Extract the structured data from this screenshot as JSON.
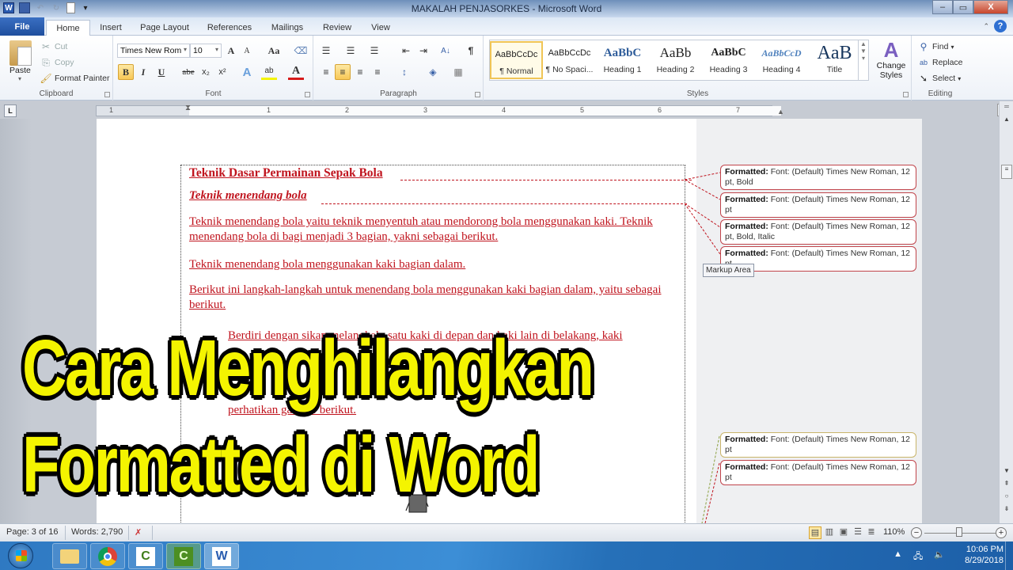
{
  "window": {
    "title": "MAKALAH PENJASORKES - Microsoft Word",
    "minimize": "–",
    "maximize": "▭",
    "close": "X"
  },
  "quick_access": [
    {
      "name": "word-logo-icon",
      "glyph": "W"
    },
    {
      "name": "save-icon",
      "glyph": ""
    },
    {
      "name": "undo-icon",
      "glyph": "↶"
    },
    {
      "name": "redo-icon",
      "glyph": "↻"
    },
    {
      "name": "new-document-icon",
      "glyph": ""
    },
    {
      "name": "customize-qat-icon",
      "glyph": "▾"
    }
  ],
  "tabs": [
    "File",
    "Home",
    "Insert",
    "Page Layout",
    "References",
    "Mailings",
    "Review",
    "View"
  ],
  "active_tab": "Home",
  "ribbon": {
    "clipboard": {
      "label": "Clipboard",
      "paste": "Paste",
      "cut": "Cut",
      "copy": "Copy",
      "format_painter": "Format Painter"
    },
    "font": {
      "label": "Font",
      "font_name": "Times New Rom",
      "font_size": "10",
      "grow": "A",
      "shrink": "A",
      "change_case": "Aa",
      "clear": "A",
      "bold": "B",
      "italic": "I",
      "underline": "U",
      "strike": "abe",
      "subscript": "x₂",
      "superscript": "x²",
      "text_effects": "A",
      "highlight": "ab",
      "font_color": "A"
    },
    "paragraph": {
      "label": "Paragraph",
      "bullets": "☰",
      "numbering": "☰",
      "multilevel": "☰",
      "decrease_indent": "⇤",
      "increase_indent": "⇥",
      "sort": "A↓",
      "show_marks": "¶",
      "align_left": "≡",
      "align_center": "≡",
      "align_right": "≡",
      "justify": "≡",
      "line_spacing": "↕",
      "shading": "◈",
      "borders": "▦"
    },
    "styles": {
      "label": "Styles",
      "items": [
        {
          "preview": "AaBbCcDc",
          "label": "¶ Normal"
        },
        {
          "preview": "AaBbCcDc",
          "label": "¶ No Spaci..."
        },
        {
          "preview": "AaBbC",
          "label": "Heading 1"
        },
        {
          "preview": "AaBb",
          "label": "Heading 2"
        },
        {
          "preview": "AaBbC",
          "label": "Heading 3"
        },
        {
          "preview": "AaBbCcD",
          "label": "Heading 4"
        },
        {
          "preview": "AaB",
          "label": "Title"
        }
      ],
      "change_styles": "Change Styles"
    },
    "editing": {
      "label": "Editing",
      "find": "Find",
      "replace": "Replace",
      "select": "Select"
    }
  },
  "ruler": {
    "numbers": [
      "1",
      "1",
      "2",
      "3",
      "4",
      "5",
      "6",
      "7"
    ]
  },
  "document": {
    "paragraphs": [
      "Teknik Dasar Permainan Sepak Bola",
      "Teknik menendang bola",
      "Teknik menendang bola yaitu teknik menyentuh atau mendorong bola menggunakan kaki. Teknik menendang bola di bagi menjadi 3 bagian, yakni sebagai berikut.",
      "Teknik menendang bola menggunakan kaki bagian dalam.",
      "Berikut ini langkah-langkah untuk menendang bola menggunakan kaki bagian dalam, yaitu sebagai berikut.",
      "Berdiri dengan sikap melangkah, satu kaki di depan dan kaki lain di belakang, kaki",
      "perhatikan gambar berikut."
    ]
  },
  "markup": {
    "tooltip": "Markup Area",
    "balloons": [
      {
        "label": "Formatted:",
        "text": "Font: (Default) Times New Roman, 12 pt, Bold"
      },
      {
        "label": "Formatted:",
        "text": "Font: (Default) Times New Roman, 12 pt"
      },
      {
        "label": "Formatted:",
        "text": "Font: (Default) Times New Roman, 12 pt, Bold, Italic"
      },
      {
        "label": "Formatted:",
        "text": "Font: (Default) Times New Roman, 12 pt"
      },
      {
        "label": "Formatted:",
        "text": "Font: (Default) Times New Roman, 12 pt"
      },
      {
        "label": "Formatted:",
        "text": "Font: (Default) Times New Roman, 12 pt"
      }
    ]
  },
  "overlay": {
    "line1": "Cara Menghilangkan",
    "line2": "Formatted di Word"
  },
  "statusbar": {
    "page": "Page: 3 of 16",
    "words": "Words: 2,790",
    "zoom": "110%",
    "zoom_minus": "−",
    "zoom_plus": "+"
  },
  "taskbar": {
    "apps": [
      {
        "name": "file-explorer",
        "glyph": "📁"
      },
      {
        "name": "chrome",
        "glyph": "◉"
      },
      {
        "name": "camtasia-recorder",
        "glyph": "C"
      },
      {
        "name": "camtasia-studio",
        "glyph": "C"
      },
      {
        "name": "word",
        "glyph": "W"
      }
    ],
    "time": "10:06 PM",
    "date": "8/29/2018"
  },
  "colors": {
    "track_change_red": "#c0141e",
    "overlay_yellow": "#f4f400",
    "file_tab_blue": "#2a5db0"
  }
}
